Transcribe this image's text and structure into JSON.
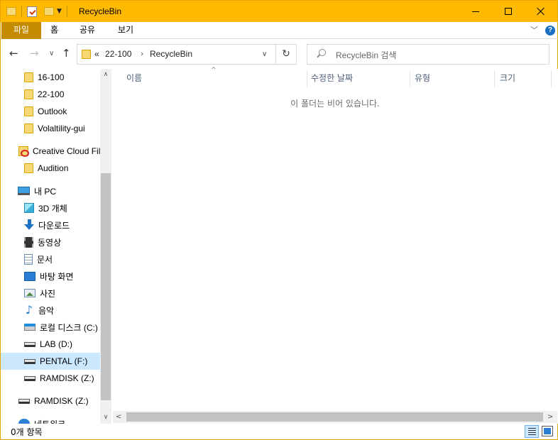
{
  "window": {
    "title": "RecycleBin"
  },
  "ribbon": {
    "tabs": [
      "파일",
      "홈",
      "공유",
      "보기"
    ],
    "help": "?"
  },
  "address": {
    "overflow": "«",
    "path": [
      "22-100",
      "RecycleBin"
    ]
  },
  "search": {
    "placeholder": "RecycleBin 검색"
  },
  "sidebar": {
    "items": [
      {
        "label": "16-100",
        "icon": "folder-icon"
      },
      {
        "label": "22-100",
        "icon": "folder-icon"
      },
      {
        "label": "Outlook",
        "icon": "folder-icon"
      },
      {
        "label": "Volaltility-gui",
        "icon": "folder-icon"
      },
      {
        "label": "Creative Cloud Fil",
        "icon": "creative-cloud-icon"
      },
      {
        "label": "Audition",
        "icon": "folder-icon"
      },
      {
        "label": "내 PC",
        "icon": "pc-icon"
      },
      {
        "label": "3D 개체",
        "icon": "3d-objects-icon"
      },
      {
        "label": "다운로드",
        "icon": "downloads-icon"
      },
      {
        "label": "동영상",
        "icon": "videos-icon"
      },
      {
        "label": "문서",
        "icon": "documents-icon"
      },
      {
        "label": "바탕 화면",
        "icon": "desktop-icon"
      },
      {
        "label": "사진",
        "icon": "pictures-icon"
      },
      {
        "label": "음악",
        "icon": "music-icon"
      },
      {
        "label": "로컬 디스크 (C:)",
        "icon": "local-disk-icon"
      },
      {
        "label": "LAB (D:)",
        "icon": "drive-icon"
      },
      {
        "label": "PENTAL (F:)",
        "icon": "drive-icon",
        "selected": true
      },
      {
        "label": "RAMDISK (Z:)",
        "icon": "drive-icon"
      },
      {
        "label": "RAMDISK (Z:)",
        "icon": "drive-icon"
      },
      {
        "label": "네트워크",
        "icon": "network-icon"
      }
    ]
  },
  "columns": {
    "name": "이름",
    "date": "수정한 날짜",
    "type": "유형",
    "size": "크기"
  },
  "content": {
    "empty_message": "이 폴더는 비어 있습니다."
  },
  "status": {
    "item_count": "0개 항목"
  }
}
